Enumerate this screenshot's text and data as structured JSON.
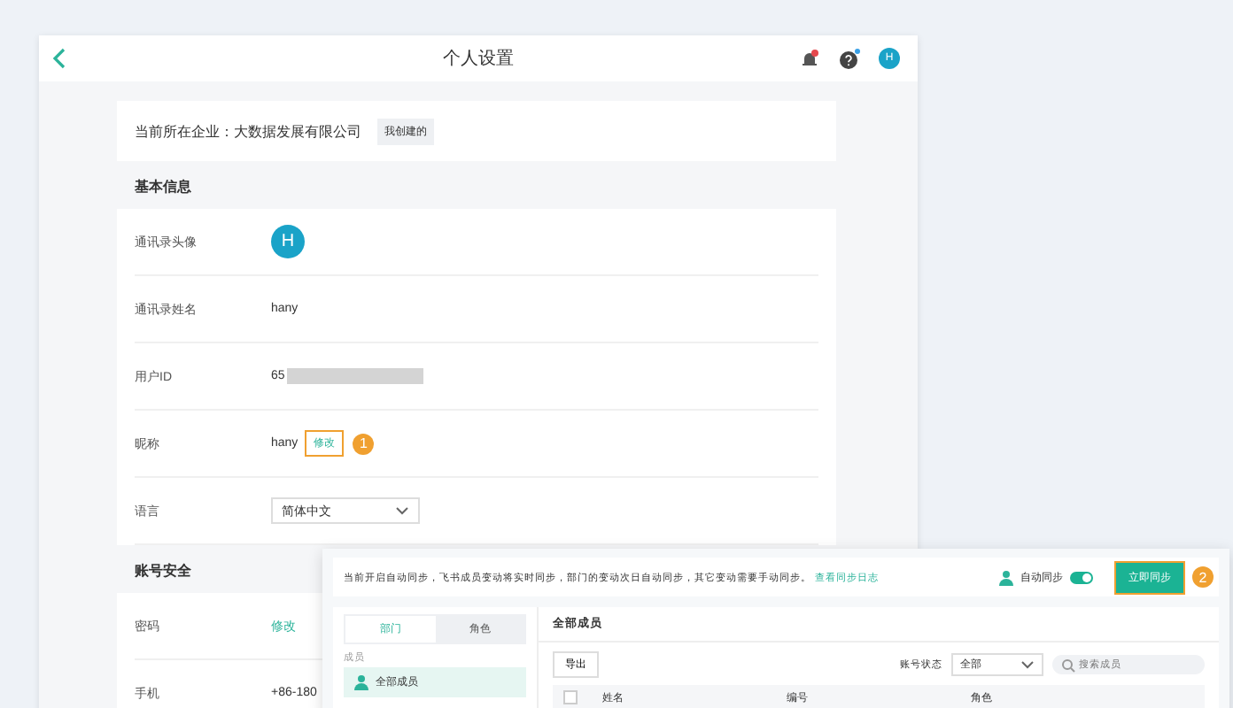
{
  "window": {
    "title": "个人设置",
    "avatar": "H"
  },
  "company": {
    "label": "当前所在企业：大数据发展有限公司",
    "tag": "我创建的"
  },
  "basic_info": {
    "title": "基本信息",
    "rows": [
      {
        "kind": "avatar",
        "label": "通讯录头像",
        "value": "H"
      },
      {
        "kind": "text",
        "label": "通讯录姓名",
        "value": "hany"
      },
      {
        "kind": "redacted",
        "label": "用户ID",
        "value": "65"
      },
      {
        "kind": "edit",
        "label": "昵称",
        "value": "hany",
        "action": "修改",
        "step": "1"
      },
      {
        "kind": "select",
        "label": "语言",
        "value": "简体中文"
      }
    ]
  },
  "security": {
    "title": "账号安全",
    "rows": [
      {
        "kind": "link",
        "label": "密码",
        "value": "修改"
      },
      {
        "kind": "text",
        "label": "手机",
        "value": "+86-180"
      }
    ]
  },
  "sync_panel": {
    "notice": "当前开启自动同步，飞书成员变动将实时同步，部门的变动次日自动同步，其它变动需要手动同步。",
    "log_link": "查看同步日志",
    "auto_sync_label": "自动同步",
    "auto_sync_on": true,
    "sync_button": "立即同步",
    "step": "2",
    "tabs": [
      {
        "label": "部门",
        "selected": true
      },
      {
        "label": "角色",
        "selected": false
      }
    ],
    "group_label": "成员",
    "groups": [
      {
        "label": "全部成员",
        "selected": true
      }
    ],
    "heading": "全部成员",
    "export_button": "导出",
    "status_label": "账号状态",
    "status_value": "全部",
    "search_placeholder": "搜索成员",
    "select_all_checked": false,
    "columns": [
      "姓名",
      "编号",
      "角色"
    ]
  }
}
